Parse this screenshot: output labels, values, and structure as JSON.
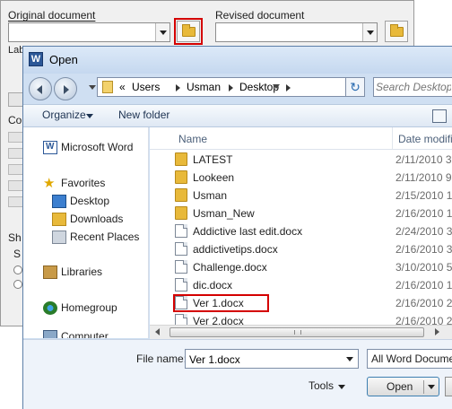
{
  "compare_dialog": {
    "original_label": "Original document",
    "revised_label": "Revised document",
    "label_cut": "Lab",
    "section_c": "Co",
    "section_s": "Sh",
    "section_s2": "S"
  },
  "open_dialog": {
    "title": "Open",
    "breadcrumb": [
      "Users",
      "Usman",
      "Desktop"
    ],
    "breadcrumb_prefix": "«",
    "search_placeholder": "Search Desktop",
    "toolbar": {
      "organize": "Organize",
      "new_folder": "New folder"
    },
    "nav": {
      "microsoft_word": "Microsoft Word",
      "favorites": "Favorites",
      "desktop": "Desktop",
      "downloads": "Downloads",
      "recent_places": "Recent Places",
      "libraries": "Libraries",
      "homegroup": "Homegroup",
      "computer": "Computer"
    },
    "columns": {
      "name": "Name",
      "date": "Date modifi"
    },
    "files": [
      {
        "name": "LATEST",
        "date": "2/11/2010 3",
        "kind": "folder"
      },
      {
        "name": "Lookeen",
        "date": "2/11/2010 9",
        "kind": "folder"
      },
      {
        "name": "Usman",
        "date": "2/15/2010 1",
        "kind": "folder"
      },
      {
        "name": "Usman_New",
        "date": "2/16/2010 1",
        "kind": "folder"
      },
      {
        "name": "Addictive last edit.docx",
        "date": "2/24/2010 3",
        "kind": "doc"
      },
      {
        "name": "addictivetips.docx",
        "date": "2/16/2010 3",
        "kind": "doc"
      },
      {
        "name": "Challenge.docx",
        "date": "3/10/2010 5",
        "kind": "doc"
      },
      {
        "name": "dic.docx",
        "date": "2/16/2010 1",
        "kind": "doc"
      },
      {
        "name": "Ver 1.docx",
        "date": "2/16/2010 2",
        "kind": "doc",
        "highlighted": true
      },
      {
        "name": "Ver 2.docx",
        "date": "2/16/2010 2",
        "kind": "doc"
      }
    ],
    "file_name_label": "File name:",
    "file_name_value": "Ver 1.docx",
    "file_type": "All Word Docume",
    "tools": "Tools",
    "open": "Open"
  },
  "colors": {
    "highlight_red": "#d40000",
    "dialog_frame": "#cfdff2",
    "word_blue": "#2b5797"
  },
  "icons": [
    "folder-icon",
    "word-icon",
    "back-icon",
    "forward-icon",
    "refresh-icon",
    "search-icon",
    "star-icon",
    "document-icon"
  ]
}
